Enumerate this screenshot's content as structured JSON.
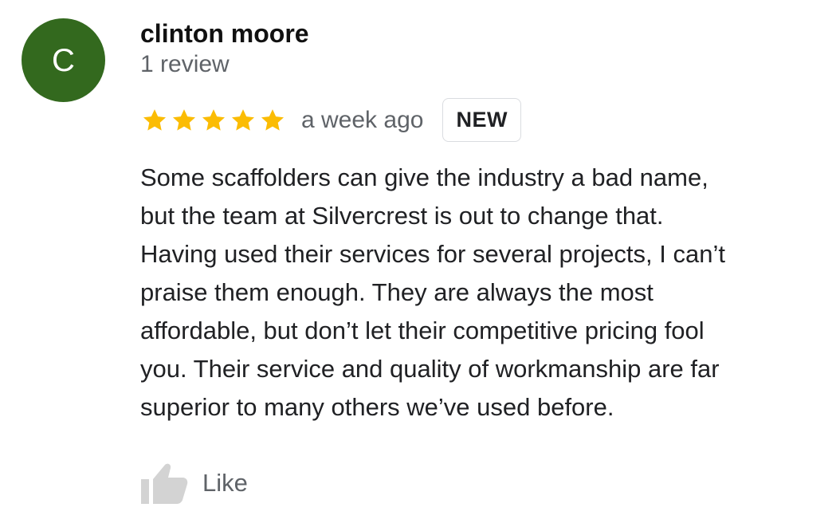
{
  "reviewer": {
    "avatar_initial": "C",
    "name": "clinton moore",
    "review_count": "1 review"
  },
  "rating": {
    "stars": 5,
    "max_stars": 5,
    "star_color": "#fbbc04"
  },
  "review": {
    "time": "a week ago",
    "badge": "NEW",
    "text": "Some scaffolders can give the industry a bad name,\nbut the team at Silvercrest is out to change that.\nHaving used their services for several projects, I can’t\npraise them enough. They are always the most\naffordable, but don’t let their competitive pricing fool\nyou. Their service and quality of workmanship are far\nsuperior to many others we’ve used before."
  },
  "actions": {
    "like_label": "Like",
    "like_icon": "thumbs-up-icon"
  },
  "colors": {
    "avatar_background": "#33691e",
    "secondary_text": "#5f6368",
    "icon_gray": "#d3d3d3"
  }
}
